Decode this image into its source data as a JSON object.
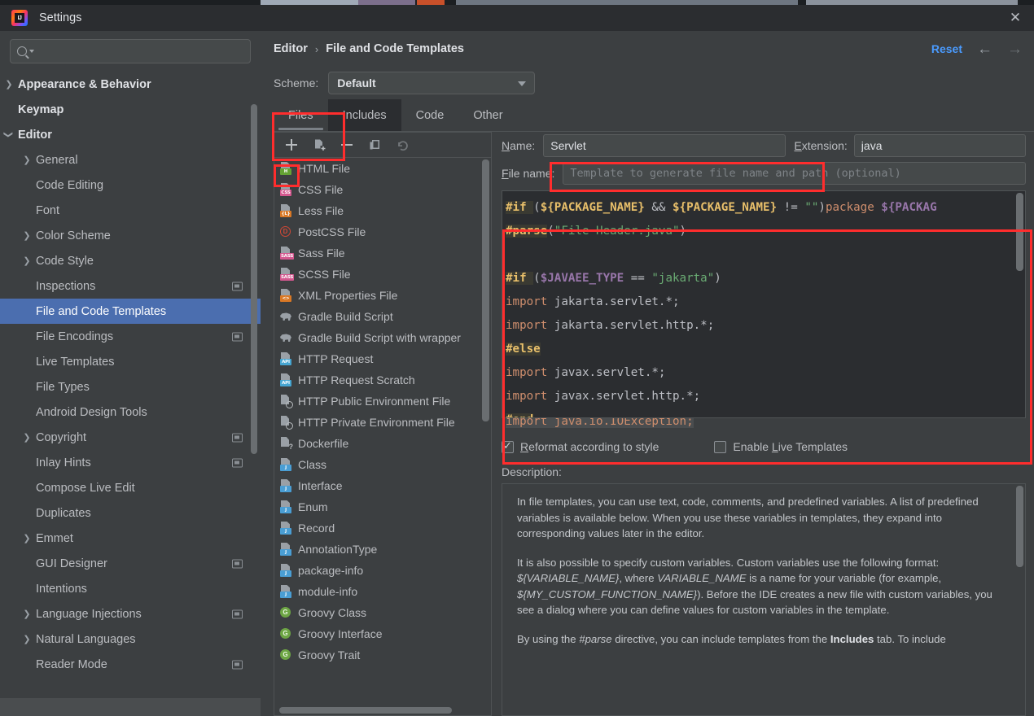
{
  "window": {
    "title": "Settings",
    "logo_text": "IJ",
    "close_label": "✕"
  },
  "sidebar": {
    "search": {
      "placeholder": "",
      "value": "",
      "icon": "search-icon"
    },
    "items": [
      {
        "label": "Appearance & Behavior",
        "level": 0,
        "twisty": "right",
        "badge": false,
        "selected": false
      },
      {
        "label": "Keymap",
        "level": 0,
        "twisty": "none",
        "badge": false,
        "selected": false
      },
      {
        "label": "Editor",
        "level": 0,
        "twisty": "down",
        "badge": false,
        "selected": false
      },
      {
        "label": "General",
        "level": 1,
        "twisty": "right",
        "badge": false,
        "selected": false
      },
      {
        "label": "Code Editing",
        "level": 1,
        "twisty": "none",
        "badge": false,
        "selected": false
      },
      {
        "label": "Font",
        "level": 1,
        "twisty": "none",
        "badge": false,
        "selected": false
      },
      {
        "label": "Color Scheme",
        "level": 1,
        "twisty": "right",
        "badge": false,
        "selected": false
      },
      {
        "label": "Code Style",
        "level": 1,
        "twisty": "right",
        "badge": false,
        "selected": false
      },
      {
        "label": "Inspections",
        "level": 1,
        "twisty": "none",
        "badge": true,
        "selected": false
      },
      {
        "label": "File and Code Templates",
        "level": 1,
        "twisty": "none",
        "badge": false,
        "selected": true
      },
      {
        "label": "File Encodings",
        "level": 1,
        "twisty": "none",
        "badge": true,
        "selected": false
      },
      {
        "label": "Live Templates",
        "level": 1,
        "twisty": "none",
        "badge": false,
        "selected": false
      },
      {
        "label": "File Types",
        "level": 1,
        "twisty": "none",
        "badge": false,
        "selected": false
      },
      {
        "label": "Android Design Tools",
        "level": 1,
        "twisty": "none",
        "badge": false,
        "selected": false
      },
      {
        "label": "Copyright",
        "level": 1,
        "twisty": "right",
        "badge": true,
        "selected": false
      },
      {
        "label": "Inlay Hints",
        "level": 1,
        "twisty": "none",
        "badge": true,
        "selected": false
      },
      {
        "label": "Compose Live Edit",
        "level": 1,
        "twisty": "none",
        "badge": false,
        "selected": false
      },
      {
        "label": "Duplicates",
        "level": 1,
        "twisty": "none",
        "badge": false,
        "selected": false
      },
      {
        "label": "Emmet",
        "level": 1,
        "twisty": "right",
        "badge": false,
        "selected": false
      },
      {
        "label": "GUI Designer",
        "level": 1,
        "twisty": "none",
        "badge": true,
        "selected": false
      },
      {
        "label": "Intentions",
        "level": 1,
        "twisty": "none",
        "badge": false,
        "selected": false
      },
      {
        "label": "Language Injections",
        "level": 1,
        "twisty": "right",
        "badge": true,
        "selected": false
      },
      {
        "label": "Natural Languages",
        "level": 1,
        "twisty": "right",
        "badge": false,
        "selected": false
      },
      {
        "label": "Reader Mode",
        "level": 1,
        "twisty": "none",
        "badge": true,
        "selected": false
      }
    ]
  },
  "header": {
    "breadcrumb": [
      "Editor",
      "File and Code Templates"
    ],
    "separator": "›",
    "reset_label": "Reset",
    "back_icon": "←",
    "forward_icon": "→"
  },
  "scheme": {
    "label": "Scheme:",
    "value": "Default"
  },
  "tabs": [
    {
      "label": "Files",
      "active": true,
      "hover": false
    },
    {
      "label": "Includes",
      "active": false,
      "hover": true
    },
    {
      "label": "Code",
      "active": false,
      "hover": false
    },
    {
      "label": "Other",
      "active": false,
      "hover": false
    }
  ],
  "template_toolbar": [
    {
      "name": "add-template-button",
      "icon": "plus-icon",
      "enabled": true
    },
    {
      "name": "copy-template-button",
      "icon": "copy-doc-icon",
      "enabled": true
    },
    {
      "name": "remove-template-button",
      "icon": "minus-icon",
      "enabled": true
    },
    {
      "name": "clone-template-button",
      "icon": "clone-icon",
      "enabled": true
    },
    {
      "name": "reset-template-button",
      "icon": "undo-icon",
      "enabled": false
    }
  ],
  "template_list": [
    {
      "label": "HTML File",
      "icon": "html-file-icon",
      "tag": "H"
    },
    {
      "label": "CSS File",
      "icon": "css-file-icon",
      "tag": "CSS"
    },
    {
      "label": "Less File",
      "icon": "less-file-icon",
      "tag": "{L}"
    },
    {
      "label": "PostCSS File",
      "icon": "postcss-file-icon",
      "tag": ""
    },
    {
      "label": "Sass File",
      "icon": "sass-file-icon",
      "tag": "SASS"
    },
    {
      "label": "SCSS File",
      "icon": "scss-file-icon",
      "tag": "SASS"
    },
    {
      "label": "XML Properties File",
      "icon": "xml-file-icon",
      "tag": "<>"
    },
    {
      "label": "Gradle Build Script",
      "icon": "gradle-icon",
      "tag": ""
    },
    {
      "label": "Gradle Build Script with wrapper",
      "icon": "gradle-icon",
      "tag": ""
    },
    {
      "label": "HTTP Request",
      "icon": "http-request-icon",
      "tag": "API"
    },
    {
      "label": "HTTP Request Scratch",
      "icon": "http-request-icon",
      "tag": "API"
    },
    {
      "label": "HTTP Public Environment File",
      "icon": "http-env-icon",
      "tag": ""
    },
    {
      "label": "HTTP Private Environment File",
      "icon": "http-env-icon",
      "tag": ""
    },
    {
      "label": "Dockerfile",
      "icon": "dockerfile-icon",
      "tag": ""
    },
    {
      "label": "Class",
      "icon": "java-class-icon",
      "tag": "J"
    },
    {
      "label": "Interface",
      "icon": "java-class-icon",
      "tag": "J"
    },
    {
      "label": "Enum",
      "icon": "java-class-icon",
      "tag": "J"
    },
    {
      "label": "Record",
      "icon": "java-class-icon",
      "tag": "J"
    },
    {
      "label": "AnnotationType",
      "icon": "java-class-icon",
      "tag": "J"
    },
    {
      "label": "package-info",
      "icon": "java-class-icon",
      "tag": "J"
    },
    {
      "label": "module-info",
      "icon": "java-class-icon",
      "tag": "J"
    },
    {
      "label": "Groovy Class",
      "icon": "groovy-icon",
      "tag": "G"
    },
    {
      "label": "Groovy Interface",
      "icon": "groovy-icon",
      "tag": "G"
    },
    {
      "label": "Groovy Trait",
      "icon": "groovy-icon",
      "tag": "G"
    }
  ],
  "detail": {
    "name_label": "Name:",
    "name_value": "Servlet",
    "extension_label": "Extension:",
    "extension_value": "java",
    "filename_label": "File name:",
    "filename_value": "",
    "filename_placeholder": "Template to generate file name and path (optional)",
    "ghost_line": "import java.io.IOException;",
    "reformat_label": "Reformat according to style",
    "reformat_checked": true,
    "live_templates_label": "Enable Live Templates",
    "live_templates_checked": false,
    "description_label": "Description:"
  },
  "code_lines": [
    [
      {
        "t": "#if ",
        "c": "dir"
      },
      {
        "t": "(",
        "c": "pln"
      },
      {
        "t": "${PACKAGE_NAME}",
        "c": "var"
      },
      {
        "t": " && ",
        "c": "op"
      },
      {
        "t": "${PACKAGE_NAME}",
        "c": "var"
      },
      {
        "t": " != ",
        "c": "op"
      },
      {
        "t": "\"\"",
        "c": "str"
      },
      {
        "t": ")",
        "c": "pln"
      },
      {
        "t": "package ",
        "c": "kw"
      },
      {
        "t": "${PACKAG",
        "c": "var2"
      }
    ],
    [
      {
        "t": "#parse",
        "c": "dir"
      },
      {
        "t": "(",
        "c": "pln"
      },
      {
        "t": "\"File Header.java\"",
        "c": "str"
      },
      {
        "t": ")",
        "c": "pln"
      }
    ],
    [],
    [
      {
        "t": "#if ",
        "c": "dir"
      },
      {
        "t": "(",
        "c": "pln"
      },
      {
        "t": "$JAVAEE_TYPE",
        "c": "var2"
      },
      {
        "t": " == ",
        "c": "op"
      },
      {
        "t": "\"jakarta\"",
        "c": "str"
      },
      {
        "t": ")",
        "c": "pln"
      }
    ],
    [
      {
        "t": "import ",
        "c": "kw"
      },
      {
        "t": "jakarta.servlet.*;",
        "c": "pln"
      }
    ],
    [
      {
        "t": "import ",
        "c": "kw"
      },
      {
        "t": "jakarta.servlet.http.*;",
        "c": "pln"
      }
    ],
    [
      {
        "t": "#else",
        "c": "dir"
      }
    ],
    [
      {
        "t": "import ",
        "c": "kw"
      },
      {
        "t": "javax.servlet.*;",
        "c": "pln"
      }
    ],
    [
      {
        "t": "import ",
        "c": "kw"
      },
      {
        "t": "javax.servlet.http.*;",
        "c": "pln"
      }
    ],
    [
      {
        "t": "#end",
        "c": "dir"
      }
    ]
  ],
  "description_paragraphs": [
    [
      {
        "t": "In file templates, you can use text, code, comments, and predefined variables. A list of predefined variables is available below. When you use these variables in templates, they expand into corresponding values later in the editor.",
        "s": "n"
      }
    ],
    [
      {
        "t": "It is also possible to specify custom variables. Custom variables use the following format: ",
        "s": "n"
      },
      {
        "t": "${VARIABLE_NAME}",
        "s": "i"
      },
      {
        "t": ", where ",
        "s": "n"
      },
      {
        "t": "VARIABLE_NAME",
        "s": "i"
      },
      {
        "t": " is a name for your variable (for example, ",
        "s": "n"
      },
      {
        "t": "${MY_CUSTOM_FUNCTION_NAME}",
        "s": "i"
      },
      {
        "t": "). Before the IDE creates a new file with custom variables, you see a dialog where you can define values for custom variables in the template.",
        "s": "n"
      }
    ],
    [
      {
        "t": "By using the ",
        "s": "n"
      },
      {
        "t": "#parse",
        "s": "i"
      },
      {
        "t": " directive, you can include templates from the ",
        "s": "n"
      },
      {
        "t": "Includes",
        "s": "b"
      },
      {
        "t": " tab. To include",
        "s": "n"
      }
    ]
  ],
  "colors": {
    "accent_blue": "#4a9bff",
    "selection_blue": "#4b6eaf",
    "annotation_red": "#ff2d2d",
    "panel_bg": "#3c3f41",
    "editor_bg": "#2b2d30"
  }
}
